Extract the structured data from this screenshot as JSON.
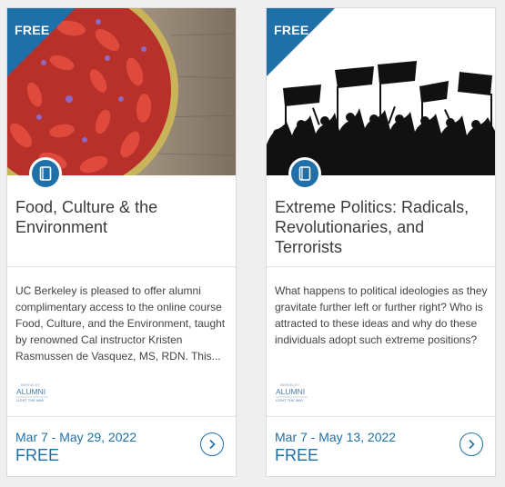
{
  "colors": {
    "accent": "#1f6fa8",
    "page_bg": "#efefef",
    "card_bg": "#ffffff"
  },
  "cards": [
    {
      "badge": "FREE",
      "image_icon": "strawberry-tart-image",
      "type_icon": "book-icon",
      "title": "Food, Culture & the Environment",
      "description": "UC Berkeley is pleased to offer alumni complimentary access to the online course Food, Culture, and the Environment, taught by renowned Cal instructor Kristen Rasmussen de Vasquez, MS, RDN. This...",
      "logo": {
        "line1": "BERKELEY",
        "line2": "ALUMNI",
        "line3": "LIGHT THE WAY"
      },
      "dates": "Mar 7 - May 29, 2022",
      "price": "FREE"
    },
    {
      "badge": "FREE",
      "image_icon": "protest-crowd-image",
      "type_icon": "book-icon",
      "title": "Extreme Politics: Radicals, Revolutionaries, and Terrorists",
      "description": "What happens to political ideologies as they gravitate further left or further right? Who is attracted to these ideas and why do these individuals adopt such extreme positions?",
      "logo": {
        "line1": "BERKELEY",
        "line2": "ALUMNI",
        "line3": "LIGHT THE WAY"
      },
      "dates": "Mar 7 - May 13, 2022",
      "price": "FREE"
    }
  ]
}
